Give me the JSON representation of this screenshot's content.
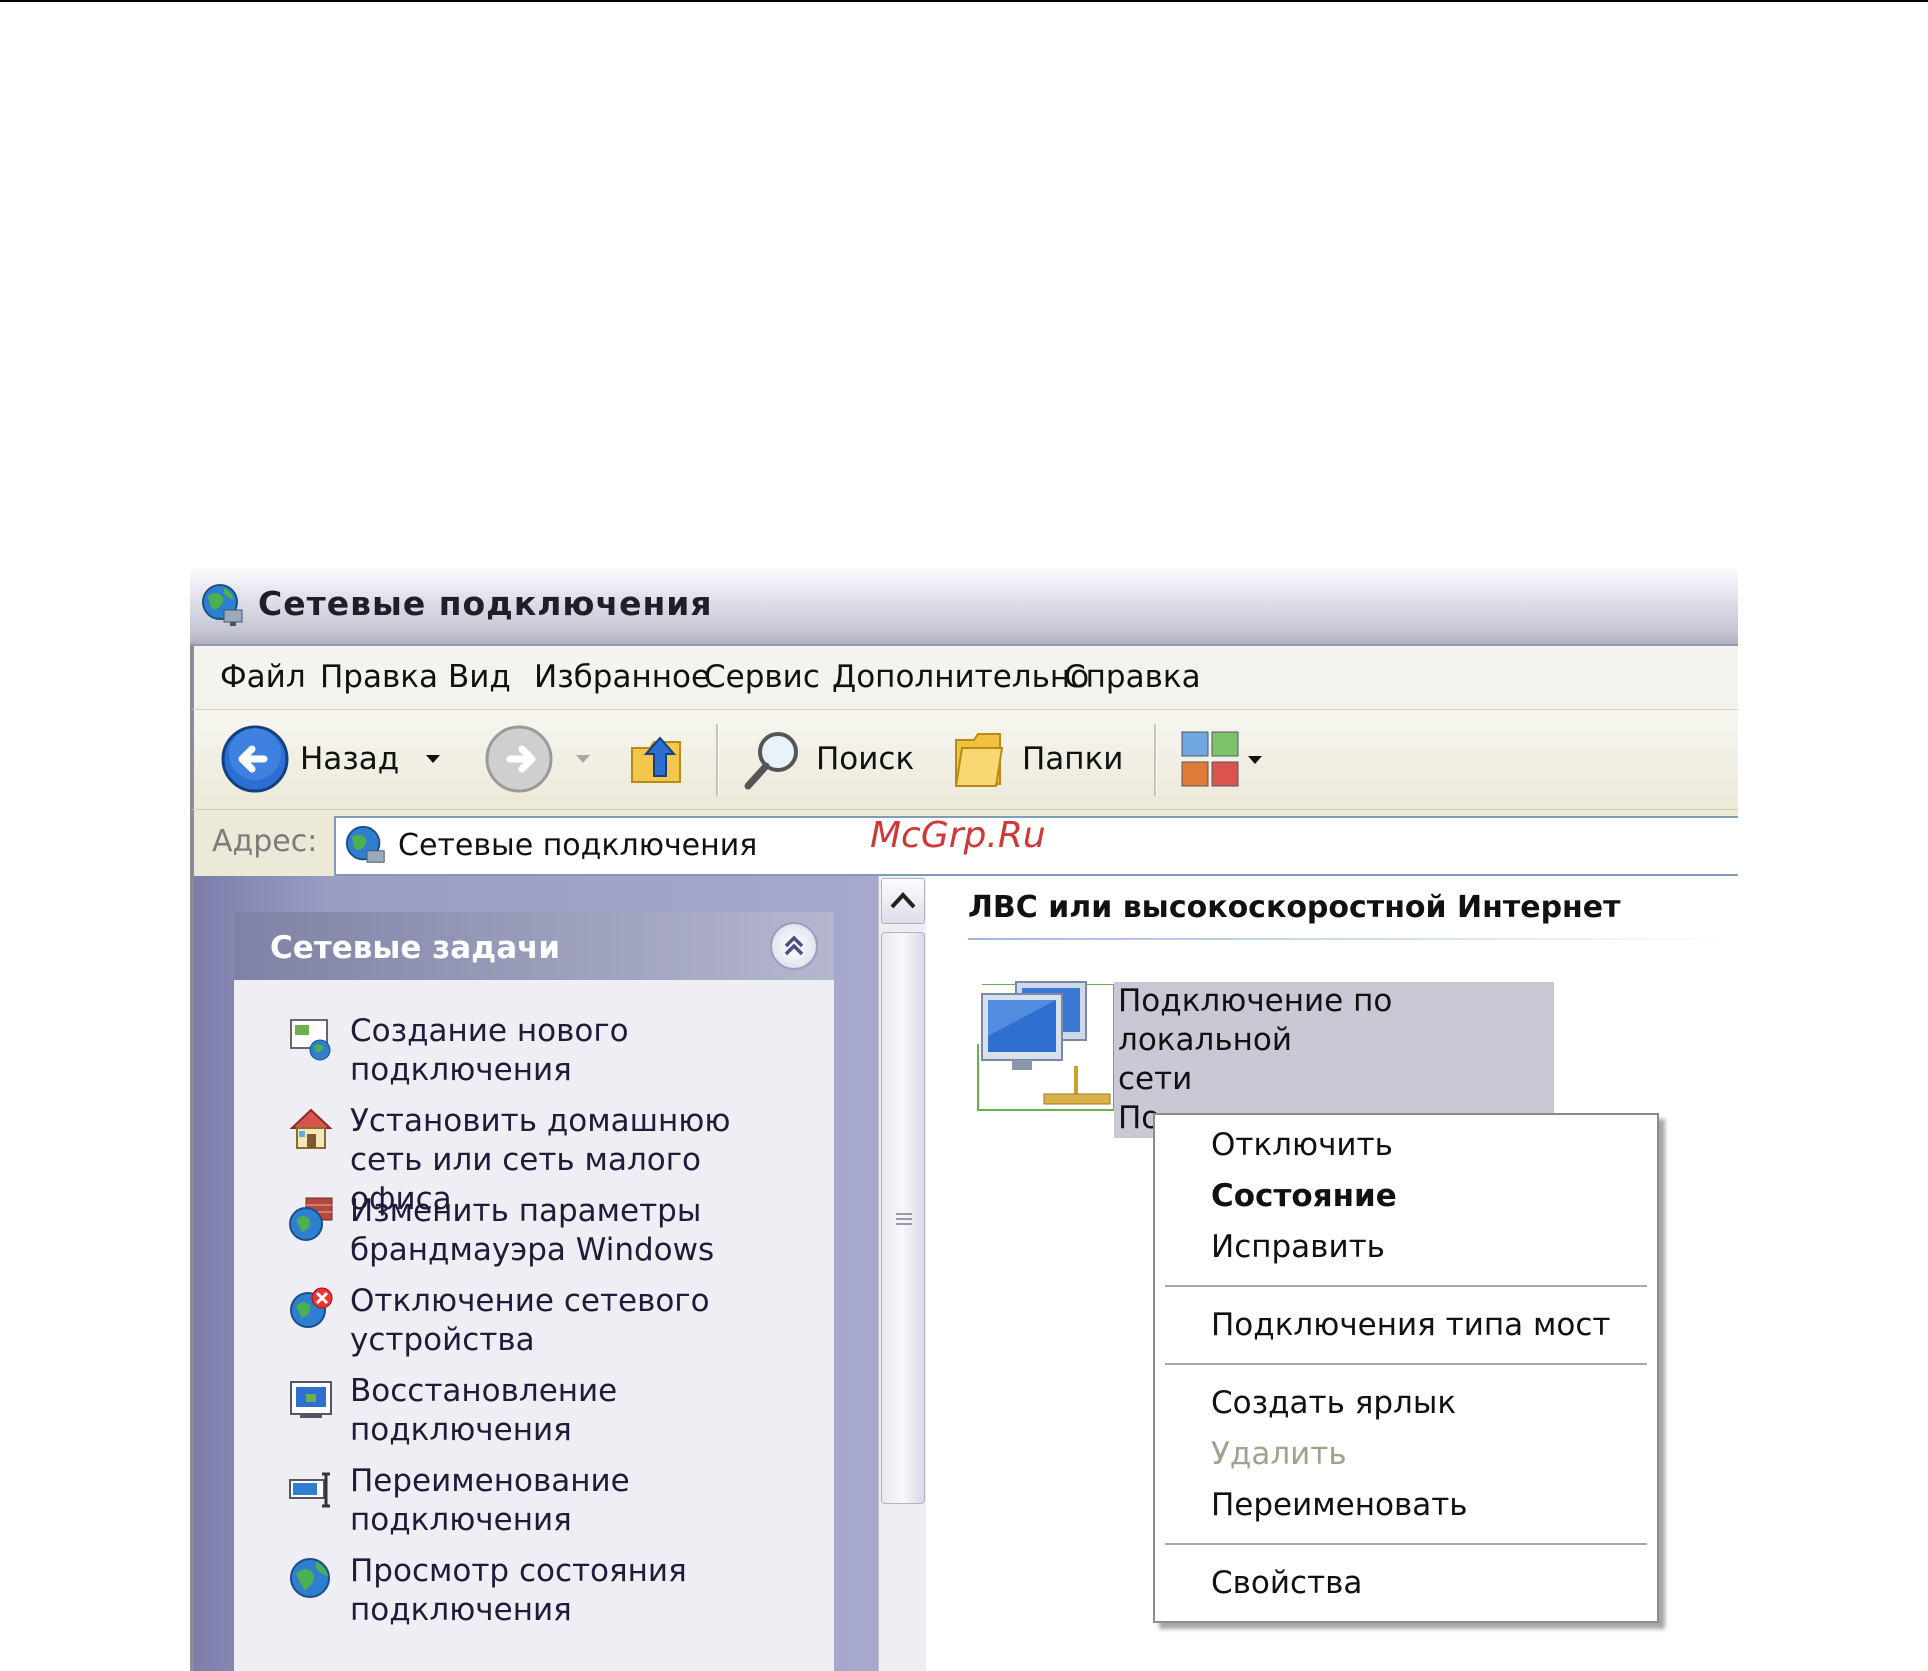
{
  "window": {
    "title": "Сетевые подключения"
  },
  "menu": [
    "Файл",
    "Правка",
    "Вид",
    "Избранное",
    "Сервис",
    "Дополнительно",
    "Справка"
  ],
  "toolbar": {
    "back_label": "Назад",
    "search_label": "Поиск",
    "folders_label": "Папки"
  },
  "address": {
    "label": "Адрес:",
    "value": "Сетевые подключения"
  },
  "taskpane": {
    "title": "Сетевые задачи",
    "tasks": [
      {
        "line1": "Создание нового",
        "line2": "подключения",
        "icon": "new-connection-icon"
      },
      {
        "line1": "Установить домашнюю",
        "line2": "сеть или сеть малого офиса",
        "icon": "home-network-icon"
      },
      {
        "line1": "Изменить параметры",
        "line2": "брандмауэра Windows",
        "icon": "firewall-icon"
      },
      {
        "line1": "Отключение сетевого",
        "line2": "устройства",
        "icon": "disable-device-icon"
      },
      {
        "line1": "Восстановление",
        "line2": "подключения",
        "icon": "repair-connection-icon"
      },
      {
        "line1": "Переименование",
        "line2": "подключения",
        "icon": "rename-connection-icon"
      },
      {
        "line1": "Просмотр состояния",
        "line2": "подключения",
        "icon": "view-status-icon"
      }
    ]
  },
  "content": {
    "group_header": "ЛВС или высокоскоростной Интернет",
    "connection": {
      "line1": "Подключение по локальной",
      "line2": "сети",
      "line3": "По"
    }
  },
  "context_menu": {
    "disable": "Отключить",
    "status": "Состояние",
    "repair": "Исправить",
    "bridge": "Подключения типа мост",
    "shortcut": "Создать ярлык",
    "delete": "Удалить",
    "rename": "Переименовать",
    "properties": "Свойства"
  },
  "watermark": "McGrp.Ru",
  "colors": {
    "selection": "#c9c8d4",
    "taskpane_header": "#7e82a4",
    "watermark": "#cc2222"
  }
}
